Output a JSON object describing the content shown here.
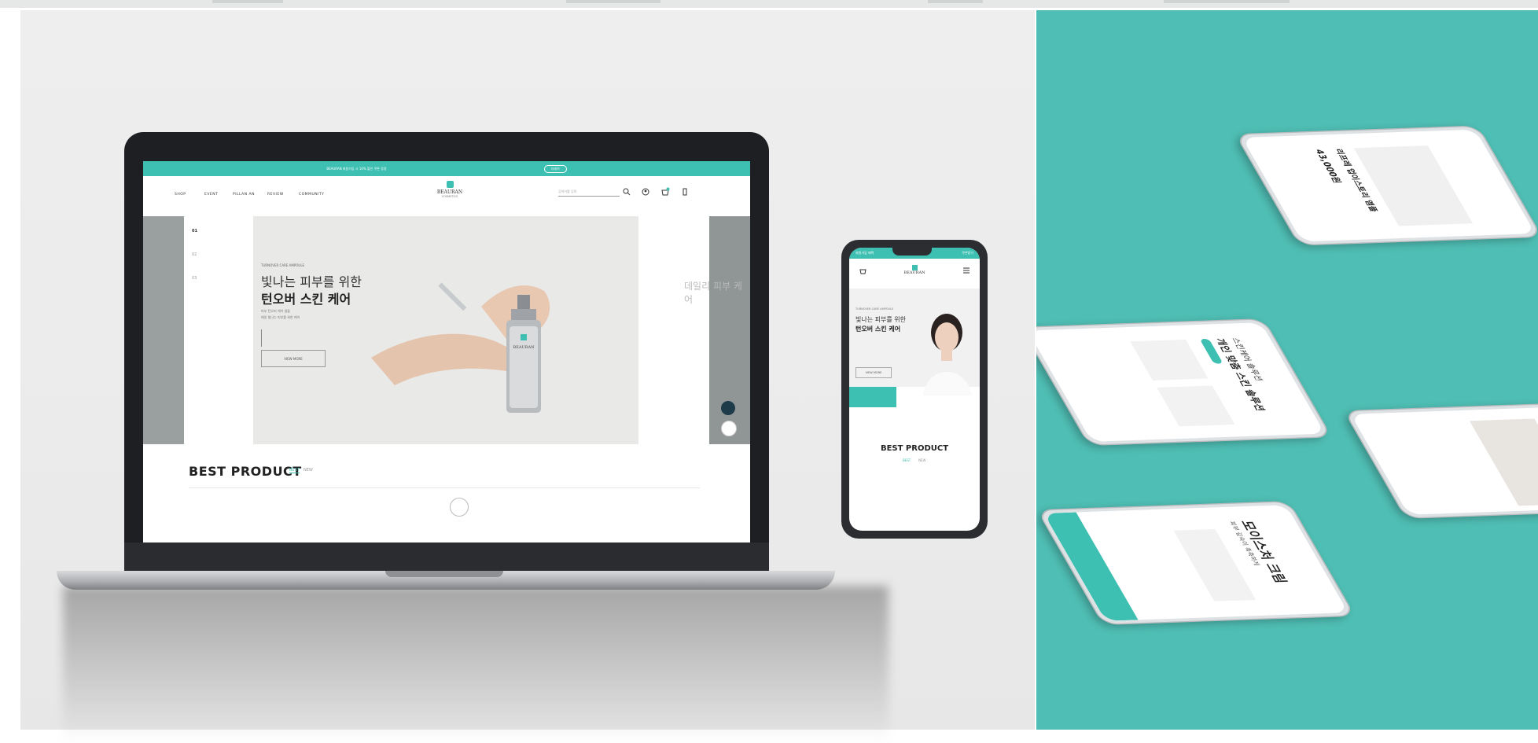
{
  "laptop_site": {
    "announcement": "BEAURAN 회원가입 시 10% 할인 쿠폰 증정",
    "announcement_btn": "자세히",
    "nav": [
      "SHOP",
      "EVENT",
      "PILLAN AN",
      "REVIEW",
      "COMMUNITY"
    ],
    "brand_name": "BEAURAN",
    "brand_sub": "COSMETICS",
    "search_placeholder": "검색어를 입력",
    "side_menu": [
      "01",
      "02",
      "03"
    ],
    "hero_eyebrow": "TURNOVER CARE AMPOULE",
    "hero_title_1": "빛나는 피부를 위한",
    "hero_title_2": "턴오버 스킨 케어",
    "hero_desc_1": "피부 턴오버 케어 앰플",
    "hero_desc_2": "매일 빛나는 피부를 위한 케어",
    "hero_btn": "VIEW MORE",
    "hero_next_title": "데일리 피부 케어",
    "section_title": "BEST PRODUCT",
    "section_tabs": [
      "BEST",
      "NEW"
    ],
    "product_label": "BEAURAN"
  },
  "phone_site": {
    "announcement": "회원가입 혜택",
    "announcement_btn": "쿠폰받기",
    "brand_name": "BEAURAN",
    "hero_eyebrow": "TURNOVER CARE AMPOULE",
    "hero_title_1": "빛나는 피부를 위한",
    "hero_title_2": "턴오버 스킨 케어",
    "hero_btn": "VIEW MORE",
    "section_title": "BEST PRODUCT",
    "section_tabs": [
      "BEST",
      "NEW"
    ]
  },
  "iso_phones": {
    "detail_price": "43,000원",
    "detail_name": "리프레 업이스토리 앰플",
    "list_title_1": "스킨케어 솔루션",
    "list_title_2": "개인 맞춤 스킨 솔루션",
    "promo_title": "모이스처 크림",
    "promo_sub": "피부 깊숙이 촉촉하게"
  },
  "colors": {
    "accent": "#3dbfb2",
    "right_bg": "#4fbeb4",
    "left_bg": "#eeeeee"
  }
}
